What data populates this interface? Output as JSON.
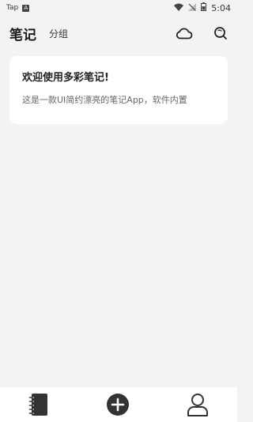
{
  "status_bar": {
    "carrier": "Tap",
    "badge_letter": "A",
    "time": "5:04"
  },
  "header": {
    "title": "笔记",
    "tab_group": "分组",
    "icons": [
      "cloud-icon",
      "search-icon"
    ]
  },
  "notes": [
    {
      "title": "欢迎使用多彩笔记!",
      "preview": "这是一款UI简约漂亮的笔记App，软件内置"
    }
  ],
  "bottom_nav": {
    "items": [
      "notebook-icon",
      "add-icon",
      "profile-icon"
    ]
  },
  "colors": {
    "background": "#f2f3f5",
    "card": "#ffffff",
    "icon": "#333333"
  }
}
